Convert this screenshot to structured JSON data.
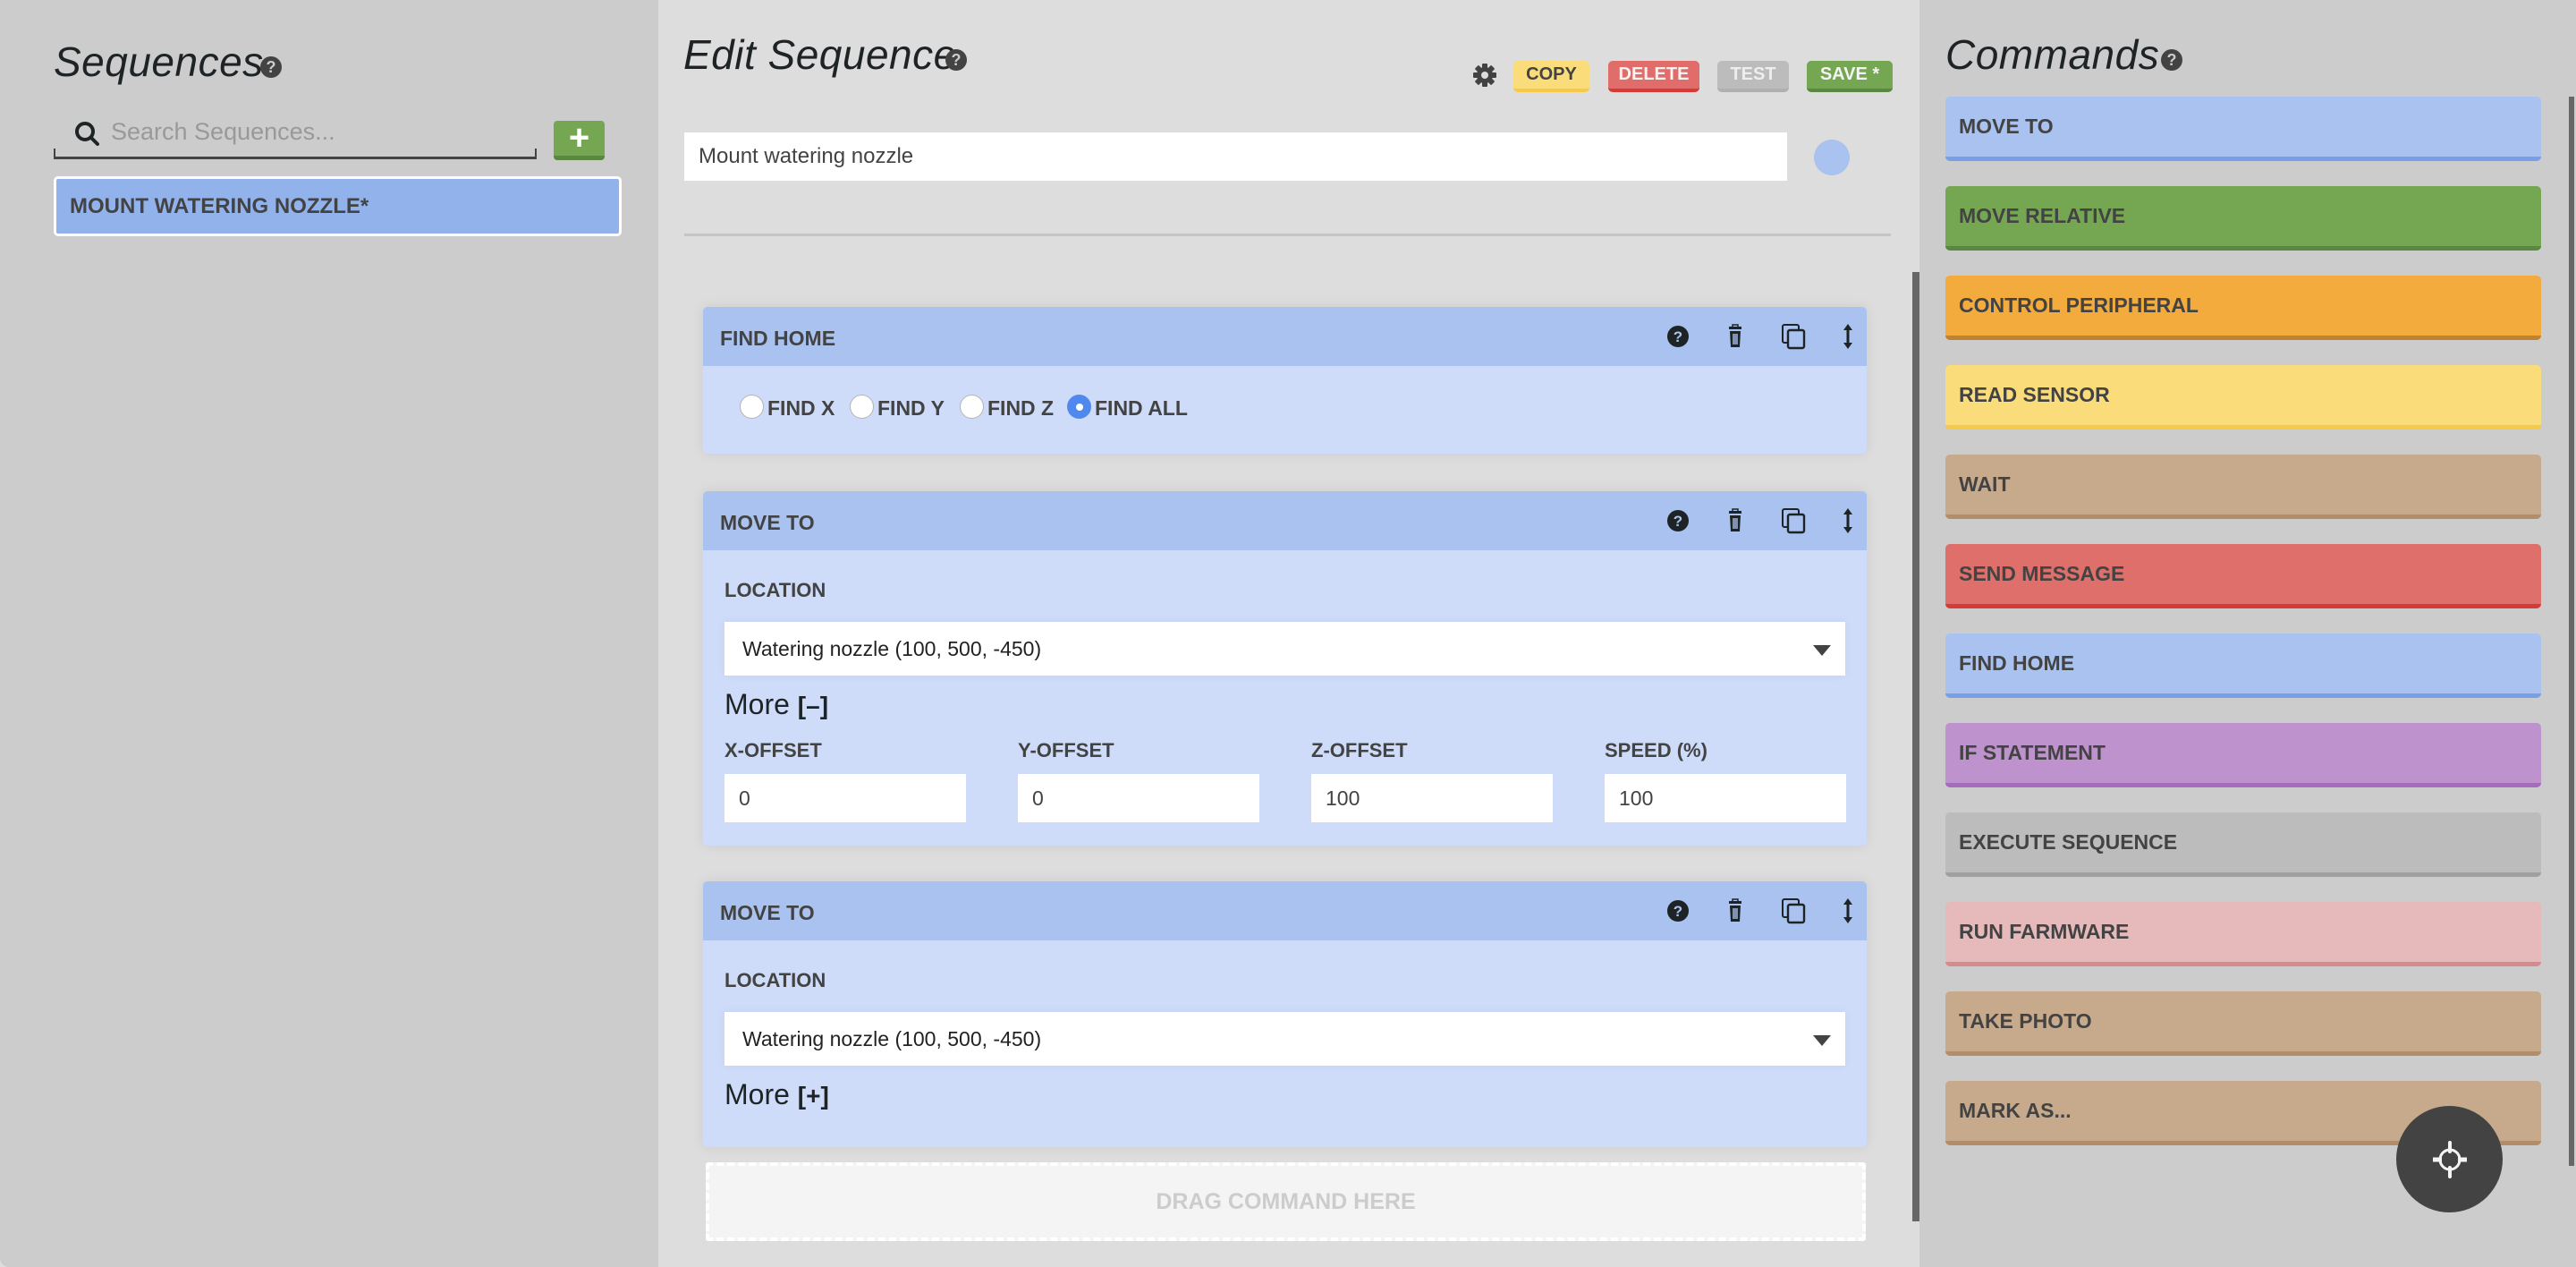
{
  "sequences_panel": {
    "title": "Sequences",
    "help_icon": "question-circle-icon",
    "search": {
      "placeholder": "Search Sequences...",
      "value": ""
    },
    "add_button_icon": "plus-icon",
    "items": [
      {
        "label": "MOUNT WATERING NOZZLE*",
        "color": "#92b2ec",
        "selected": true
      }
    ]
  },
  "editor": {
    "title": "Edit Sequence",
    "help_icon": "question-circle-icon",
    "toolbar": {
      "settings_icon": "gear-icon",
      "copy_label": "COPY",
      "delete_label": "DELETE",
      "test_label": "TEST",
      "save_label": "SAVE *"
    },
    "sequence_name": "Mount watering nozzle",
    "sequence_color": "#a9c2ef",
    "step_icons": [
      "question-circle-icon",
      "trash-icon",
      "clone-icon",
      "drag-arrows-icon"
    ],
    "steps": [
      {
        "title": "FIND HOME",
        "options": [
          {
            "label": "FIND X",
            "checked": false
          },
          {
            "label": "FIND Y",
            "checked": false
          },
          {
            "label": "FIND Z",
            "checked": false
          },
          {
            "label": "FIND ALL",
            "checked": true
          }
        ]
      },
      {
        "title": "MOVE TO",
        "location_label": "LOCATION",
        "location_value": "Watering nozzle (100, 500, -450)",
        "more_label": "More",
        "more_toggle": "[–]",
        "expanded": true,
        "fields": [
          {
            "label": "X-OFFSET",
            "value": "0"
          },
          {
            "label": "Y-OFFSET",
            "value": "0"
          },
          {
            "label": "Z-OFFSET",
            "value": "100"
          },
          {
            "label": "SPEED (%)",
            "value": "100"
          }
        ]
      },
      {
        "title": "MOVE TO",
        "location_label": "LOCATION",
        "location_value": "Watering nozzle (100, 500, -450)",
        "more_label": "More",
        "more_toggle": "[+]",
        "expanded": false
      }
    ],
    "drop_zone_label": "DRAG COMMAND HERE"
  },
  "commands_panel": {
    "title": "Commands",
    "help_icon": "question-circle-icon",
    "items": [
      {
        "label": "MOVE TO",
        "color": "#a9c2ef",
        "border": "#789fe8"
      },
      {
        "label": "MOVE RELATIVE",
        "color": "#75a753",
        "border": "#5a8742"
      },
      {
        "label": "CONTROL PERIPHERAL",
        "color": "#f3ab3d",
        "border": "#bf8230"
      },
      {
        "label": "READ SENSOR",
        "color": "#fadd7a",
        "border": "#f7c948"
      },
      {
        "label": "WAIT",
        "color": "#c7aa8c",
        "border": "#b38d68"
      },
      {
        "label": "SEND MESSAGE",
        "color": "#de6f6a",
        "border": "#d63a36"
      },
      {
        "label": "FIND HOME",
        "color": "#a9c2ef",
        "border": "#789fe8"
      },
      {
        "label": "IF STATEMENT",
        "color": "#be92cc",
        "border": "#a46bbf"
      },
      {
        "label": "EXECUTE SEQUENCE",
        "color": "#bcbcbc",
        "border": "#a0a0a0"
      },
      {
        "label": "RUN FARMWARE",
        "color": "#e6b9bb",
        "border": "#d68a8d"
      },
      {
        "label": "TAKE PHOTO",
        "color": "#c7aa8c",
        "border": "#b38d68"
      },
      {
        "label": "MARK AS...",
        "color": "#c7aa8c",
        "border": "#b38d68"
      }
    ]
  },
  "fab_icon": "crosshair-icon"
}
